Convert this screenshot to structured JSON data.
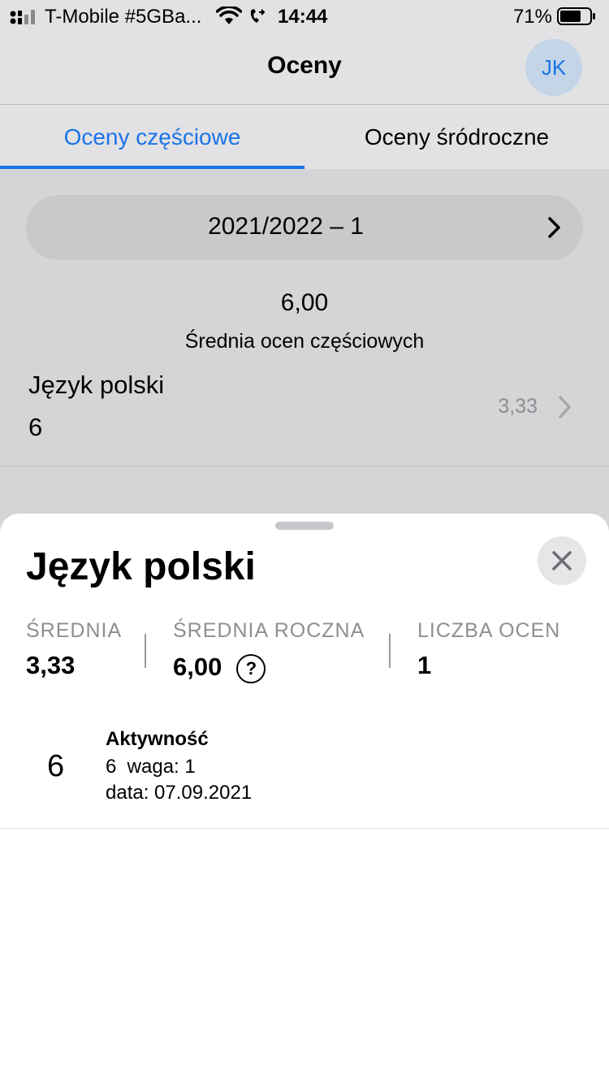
{
  "status_bar": {
    "carrier": "T-Mobile #5GBa...",
    "time": "14:44",
    "battery_percent": "71%",
    "battery_level": 0.71,
    "icons": [
      "signal-icon",
      "wifi-icon",
      "call-forward-icon",
      "battery-icon"
    ]
  },
  "nav": {
    "title": "Oceny",
    "avatar_initials": "JK"
  },
  "tabs": [
    {
      "label": "Oceny częściowe",
      "active": true
    },
    {
      "label": "Oceny śródroczne",
      "active": false
    }
  ],
  "period": {
    "label": "2021/2022 – 1"
  },
  "summary": {
    "average": "6,00",
    "average_label": "Średnia ocen częściowych"
  },
  "subjects": [
    {
      "name": "Język polski",
      "grades": "6",
      "average": "3,33"
    }
  ],
  "sheet": {
    "title": "Język polski",
    "stats": [
      {
        "label": "ŚREDNIA",
        "value": "3,33"
      },
      {
        "label": "ŚREDNIA ROCZNA",
        "value": "6,00",
        "help_icon": "?"
      },
      {
        "label": "LICZBA OCEN",
        "value": "1"
      }
    ],
    "grades": [
      {
        "grade": "6",
        "category": "Aktywność",
        "detail": "6  waga: 1",
        "date": "data: 07.09.2021"
      }
    ]
  },
  "colors": {
    "accent": "#1a73e8",
    "muted": "#8e8e93",
    "background": "#e2e2e4"
  }
}
